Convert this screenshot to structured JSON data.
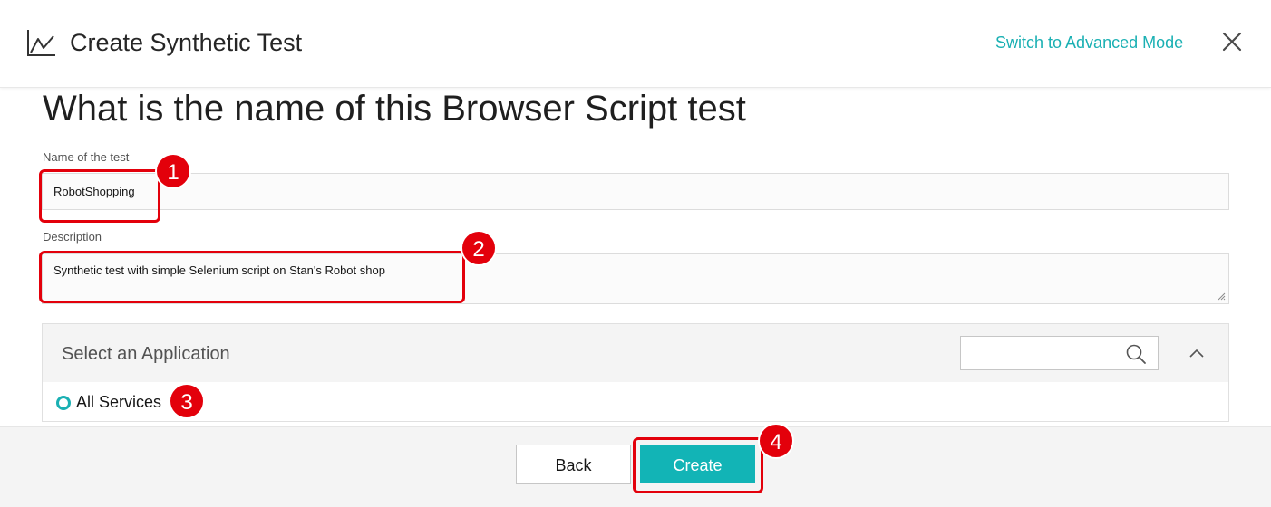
{
  "header": {
    "title": "Create Synthetic Test",
    "icon": "line-chart-icon",
    "advanced_link": "Switch to Advanced Mode",
    "close_icon": "close-icon"
  },
  "page": {
    "title": "What is the name of this Browser Script test"
  },
  "form": {
    "name_label": "Name of the test",
    "name_value": "RobotShopping",
    "description_label": "Description",
    "description_value": "Synthetic test with simple Selenium script on Stan's Robot shop"
  },
  "app_selector": {
    "title": "Select an Application",
    "search_value": "",
    "search_icon": "search-icon",
    "collapse_icon": "chevron-up-icon",
    "options": [
      {
        "label": "All Services",
        "selected": true
      }
    ]
  },
  "footer": {
    "back_label": "Back",
    "create_label": "Create"
  },
  "annotations": [
    "1",
    "2",
    "3",
    "4"
  ],
  "colors": {
    "accent": "#12b4b6",
    "link": "#1ab0b3",
    "annotation": "#e3000b"
  }
}
